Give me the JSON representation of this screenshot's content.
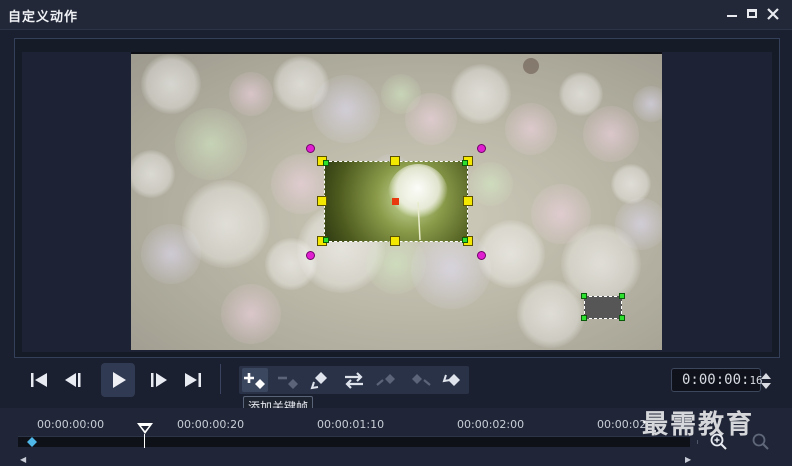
{
  "window": {
    "title": "自定义动作",
    "minimize_icon": "minimize-icon",
    "maximize_icon": "maximize-icon",
    "close_icon": "close-icon"
  },
  "playback": {
    "buttons": [
      {
        "name": "go-to-start",
        "icon": "skip-start-icon"
      },
      {
        "name": "previous-frame",
        "icon": "step-back-icon"
      },
      {
        "name": "play",
        "icon": "play-icon"
      },
      {
        "name": "next-frame",
        "icon": "step-forward-icon"
      },
      {
        "name": "go-to-end",
        "icon": "skip-end-icon"
      }
    ]
  },
  "keyframes": {
    "buttons": [
      {
        "name": "add-keyframe",
        "icon": "add-keyframe-icon",
        "enabled": true
      },
      {
        "name": "remove-keyframe",
        "icon": "remove-keyframe-icon",
        "enabled": false
      },
      {
        "name": "flip-keyframe",
        "icon": "flip-keyframe-icon",
        "enabled": true
      },
      {
        "name": "swap-keyframe",
        "icon": "swap-icon",
        "enabled": true
      },
      {
        "name": "previous-keyframe",
        "icon": "prev-keyframe-icon",
        "enabled": false
      },
      {
        "name": "next-keyframe",
        "icon": "next-keyframe-icon",
        "enabled": false
      },
      {
        "name": "reset-keyframe",
        "icon": "reset-keyframe-icon",
        "enabled": true
      }
    ],
    "tooltip": "添加关键帧"
  },
  "timecode": {
    "main": "0:00:00:",
    "frames": "16"
  },
  "timeline": {
    "ticks": [
      "00:00:00:00",
      "00:00:00:20",
      "00:00:01:10",
      "00:00:02:00",
      "00:00:02"
    ],
    "zoom_in_icon": "zoom-in-icon",
    "zoom_out_icon": "zoom-out-icon"
  },
  "watermark": "最需教育",
  "colors": {
    "handle_yellow": "#f5e800",
    "handle_green": "#2de030",
    "handle_magenta": "#e020d0",
    "center_red": "#e8380d",
    "accent_blue": "#4fb6e8"
  }
}
